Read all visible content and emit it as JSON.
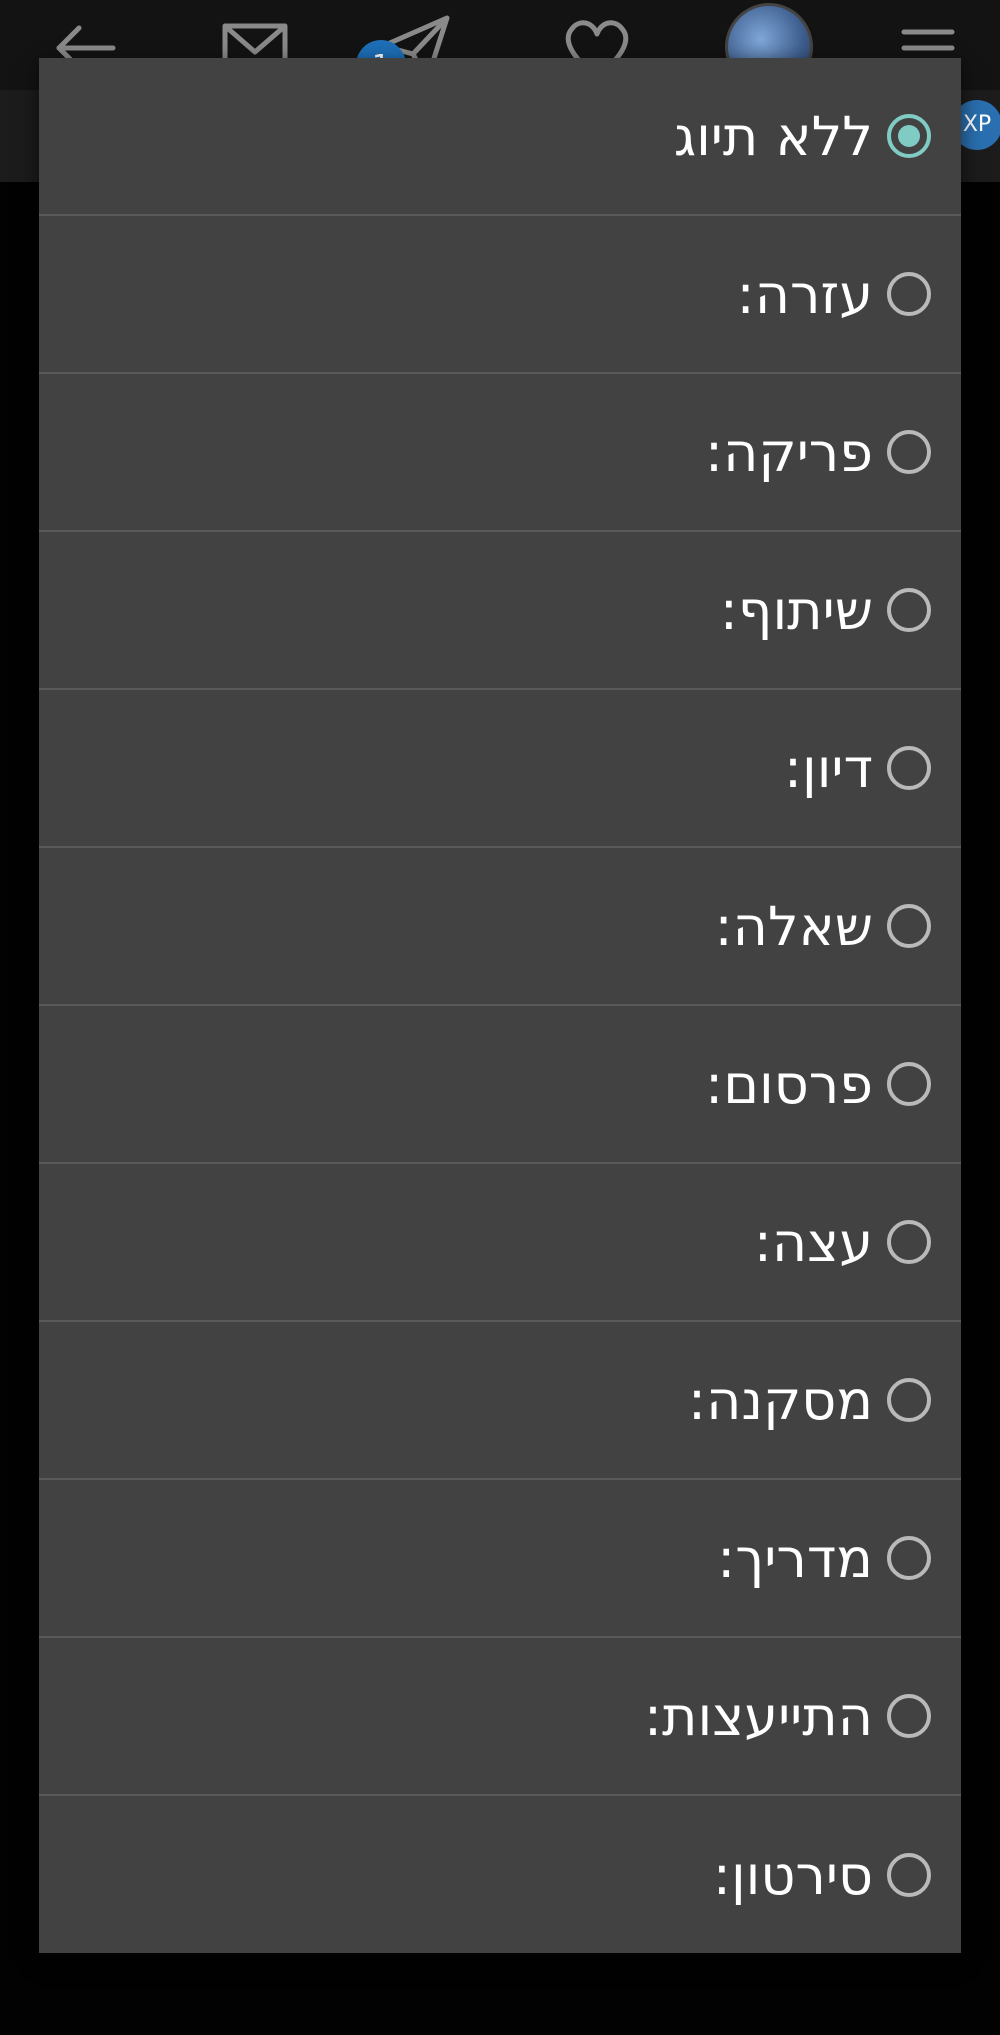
{
  "topbar": {
    "icons": [
      "back-arrow-icon",
      "mail-icon",
      "send-icon",
      "heart-icon",
      "avatar",
      "menu-icon"
    ],
    "notification_count": "1"
  },
  "subbar": {
    "badge_text": "XP"
  },
  "dialog": {
    "selected_index": 0,
    "options": [
      {
        "label": "ללא תיוג"
      },
      {
        "label": "עזרה:"
      },
      {
        "label": "פריקה:"
      },
      {
        "label": "שיתוף:"
      },
      {
        "label": "דיון:"
      },
      {
        "label": "שאלה:"
      },
      {
        "label": "פרסום:"
      },
      {
        "label": "עצה:"
      },
      {
        "label": "מסקנה:"
      },
      {
        "label": "מדריך:"
      },
      {
        "label": "התייעצות:"
      },
      {
        "label": "סירטון:"
      }
    ]
  },
  "colors": {
    "dialog_bg": "#424242",
    "accent": "#80cbc4",
    "text": "#ffffff"
  }
}
